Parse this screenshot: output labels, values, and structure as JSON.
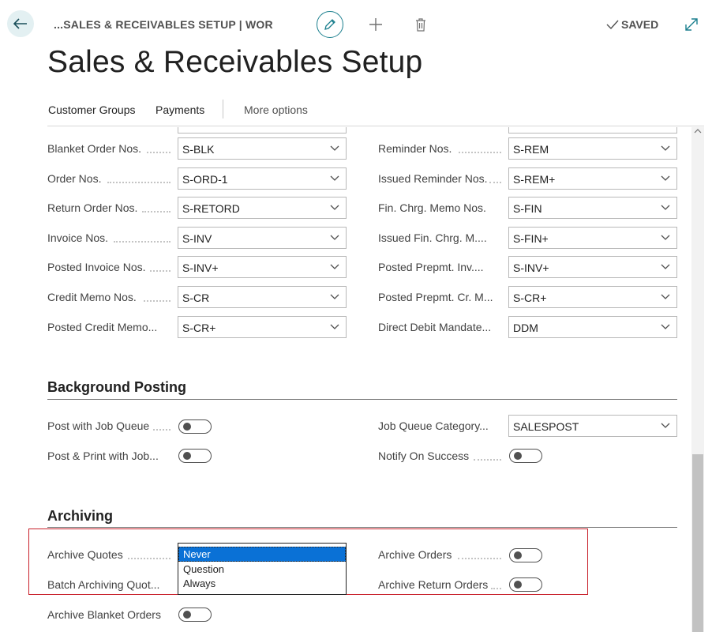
{
  "breadcrumb": "...SALES & RECEIVABLES SETUP | WOR",
  "status": {
    "saved_label": "SAVED"
  },
  "page_title": "Sales & Receivables Setup",
  "actions": {
    "customer_groups": "Customer Groups",
    "payments": "Payments",
    "more_options": "More options"
  },
  "number_series": {
    "left": [
      {
        "label": "Blanket Order Nos.",
        "value": "S-BLK"
      },
      {
        "label": "Order Nos.",
        "value": "S-ORD-1"
      },
      {
        "label": "Return Order Nos.",
        "value": "S-RETORD"
      },
      {
        "label": "Invoice Nos.",
        "value": "S-INV"
      },
      {
        "label": "Posted Invoice Nos.",
        "value": "S-INV+"
      },
      {
        "label": "Credit Memo Nos.",
        "value": "S-CR"
      },
      {
        "label": "Posted Credit Memo...",
        "value": "S-CR+"
      }
    ],
    "right": [
      {
        "label": "Reminder Nos.",
        "value": "S-REM"
      },
      {
        "label": "Issued Reminder Nos.",
        "value": "S-REM+"
      },
      {
        "label": "Fin. Chrg. Memo Nos.",
        "value": "S-FIN"
      },
      {
        "label": "Issued Fin. Chrg. M....",
        "value": "S-FIN+"
      },
      {
        "label": "Posted Prepmt. Inv....",
        "value": "S-INV+"
      },
      {
        "label": "Posted Prepmt. Cr. M...",
        "value": "S-CR+"
      },
      {
        "label": "Direct Debit Mandate...",
        "value": "DDM"
      }
    ]
  },
  "background_posting": {
    "title": "Background Posting",
    "post_with_job_queue": {
      "label": "Post with Job Queue",
      "on": false
    },
    "post_print_with_job": {
      "label": "Post & Print with Job...",
      "on": false
    },
    "job_queue_category": {
      "label": "Job Queue Category...",
      "value": "SALESPOST"
    },
    "notify_on_success": {
      "label": "Notify On Success",
      "on": false
    }
  },
  "archiving": {
    "title": "Archiving",
    "archive_quotes": {
      "label": "Archive Quotes"
    },
    "batch_archiving_quotes": {
      "label": "Batch Archiving Quot..."
    },
    "archive_orders": {
      "label": "Archive Orders",
      "on": false
    },
    "archive_return_orders": {
      "label": "Archive Return Orders",
      "on": false
    },
    "archive_blanket_orders": {
      "label": "Archive Blanket Orders",
      "on": false
    },
    "quotes_options": [
      "Never",
      "Question",
      "Always"
    ],
    "quotes_selected": "Never"
  },
  "colors": {
    "accent": "#1b7f8e",
    "selection": "#0a71d6",
    "highlight_border": "#c8202a"
  }
}
